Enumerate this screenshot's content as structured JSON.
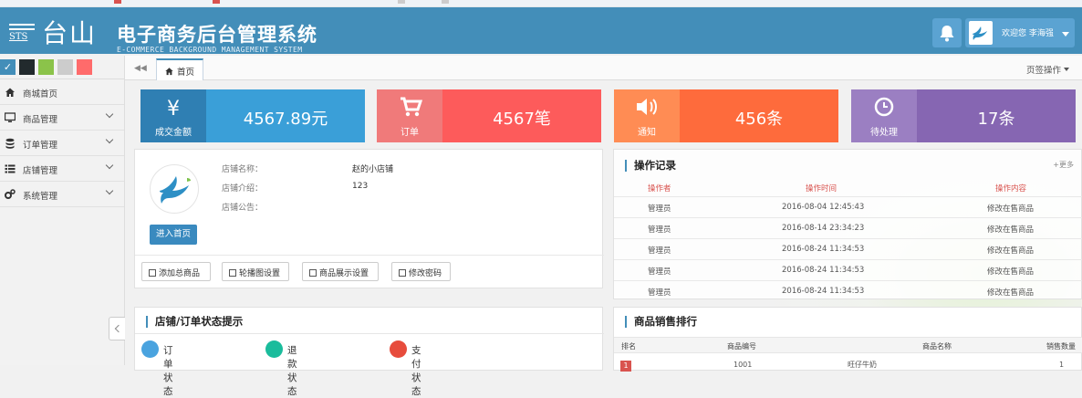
{
  "colors": {
    "header": "#438eb9",
    "sales": "#3a9fd8",
    "sales_dark": "#2f7fb3",
    "order": "#fd5b5b",
    "order_dark": "#e94c4c",
    "notice": "#fe6b3c",
    "notice_dark": "#ff8c54",
    "pending": "#9b7fc2",
    "pending_dark": "#8666b2"
  },
  "header": {
    "logo_text": "台山",
    "logo_sts": "STS",
    "title": "电子商务后台管理系统",
    "subtitle": "E-COMMERCE BACKGROUND MANAGEMENT SYSTEM",
    "user_greeting": "欢迎您 李海强",
    "bell_icon": "bell-icon"
  },
  "sidebar": {
    "skins": [
      "#438eb9",
      "#222a2d",
      "#8bc34a",
      "#cccccc",
      "#ff6b6b"
    ],
    "items": [
      {
        "label": "商城首页",
        "icon": "home-icon"
      },
      {
        "label": "商品管理",
        "icon": "desktop-icon"
      },
      {
        "label": "订单管理",
        "icon": "database-icon"
      },
      {
        "label": "店铺管理",
        "icon": "list-icon"
      },
      {
        "label": "系统管理",
        "icon": "cogs-icon"
      }
    ]
  },
  "tabs": {
    "home": "首页",
    "ops": "页签操作"
  },
  "stats": [
    {
      "title": "成交金额",
      "value": "4567.89元",
      "icon": "yen-icon"
    },
    {
      "title": "订单",
      "value": "4567笔",
      "icon": "cart-icon"
    },
    {
      "title": "通知",
      "value": "456条",
      "icon": "volume-icon"
    },
    {
      "title": "待处理",
      "value": "17条",
      "icon": "clock-icon"
    }
  ],
  "shop": {
    "name_label": "店铺名称：",
    "name": "赵的小店铺",
    "intro_label": "店铺介绍：",
    "intro": "123",
    "notice_label": "店铺公告：",
    "enter": "进入首页",
    "buttons": [
      "添加总商品",
      "轮播图设置",
      "商品展示设置",
      "修改密码"
    ]
  },
  "oplog": {
    "title": "操作记录",
    "more": "+更多",
    "headers": [
      "操作者",
      "操作时间",
      "操作内容"
    ],
    "rows": [
      [
        "管理员",
        "2016-08-04 12:45:43",
        "修改在售商品"
      ],
      [
        "管理员",
        "2016-08-14 23:34:23",
        "修改在售商品"
      ],
      [
        "管理员",
        "2016-08-24 11:34:53",
        "修改在售商品"
      ],
      [
        "管理员",
        "2016-08-24 11:34:53",
        "修改在售商品"
      ],
      [
        "管理员",
        "2016-08-24 11:34:53",
        "修改在售商品"
      ]
    ]
  },
  "status": {
    "title": "店铺/订单状态提示",
    "items": [
      "订单状态",
      "退款状态",
      "支付状态"
    ]
  },
  "ranking": {
    "title": "商品销售排行",
    "headers": [
      "排名",
      "商品编号",
      "商品名称",
      "销售数量"
    ],
    "first": {
      "rank": "1",
      "code": "1001",
      "name": "旺仔牛奶",
      "qty": "1"
    }
  }
}
